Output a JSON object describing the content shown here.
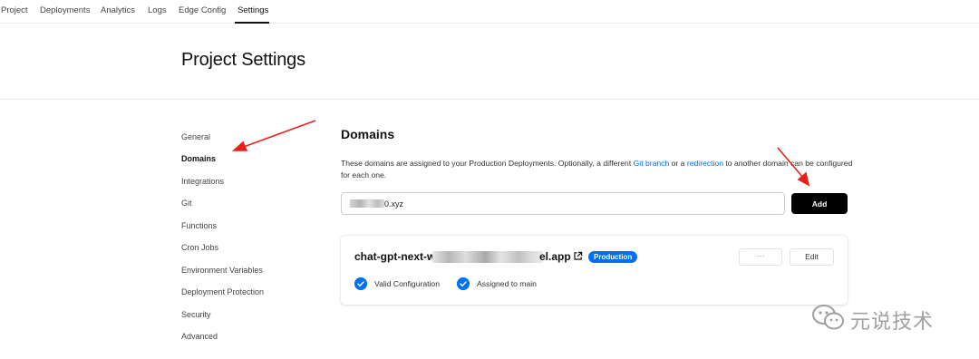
{
  "nav": {
    "tabs": [
      {
        "label": "Project"
      },
      {
        "label": "Deployments"
      },
      {
        "label": "Analytics"
      },
      {
        "label": "Logs"
      },
      {
        "label": "Edge Config"
      },
      {
        "label": "Settings",
        "active": true
      }
    ]
  },
  "header": {
    "title": "Project Settings"
  },
  "sidebar": {
    "items": [
      {
        "label": "General"
      },
      {
        "label": "Domains",
        "active": true
      },
      {
        "label": "Integrations"
      },
      {
        "label": "Git"
      },
      {
        "label": "Functions"
      },
      {
        "label": "Cron Jobs"
      },
      {
        "label": "Environment Variables"
      },
      {
        "label": "Deployment Protection"
      },
      {
        "label": "Security"
      },
      {
        "label": "Advanced"
      }
    ]
  },
  "domains": {
    "title": "Domains",
    "description": {
      "part1": "These domains are assigned to your Production Deployments. Optionally, a different ",
      "link1": "Git branch",
      "part2": " or a ",
      "link2": "redirection",
      "part3": " to another domain can be configured for each one."
    },
    "input_value": "0.xyz",
    "add_label": "Add",
    "card": {
      "domain_prefix": "chat-gpt-next-w",
      "domain_suffix": "el.app",
      "badge": "Production",
      "more_label": "···",
      "edit_label": "Edit",
      "statuses": [
        {
          "label": "Valid Configuration"
        },
        {
          "label": "Assigned to main"
        }
      ]
    }
  },
  "watermark": {
    "text": "元说技术",
    "icon": "wechat-icon"
  },
  "colors": {
    "accent": "#0070f3",
    "annotation_arrow": "#e8201a",
    "primary_button": "#000000"
  }
}
